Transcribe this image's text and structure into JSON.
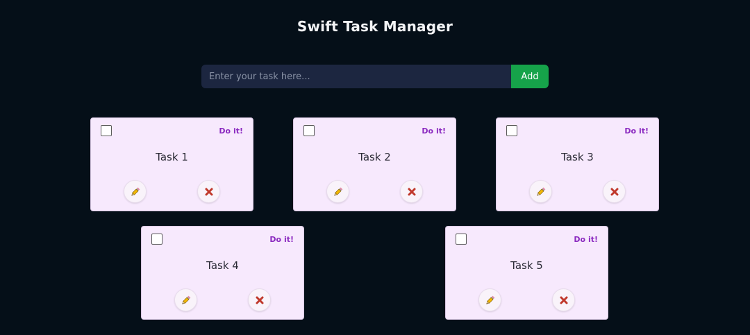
{
  "header": {
    "title": "Swift Task Manager"
  },
  "form": {
    "placeholder": "Enter your task here...",
    "add_label": "Add"
  },
  "colors": {
    "background": "#050f18",
    "card": "#f7e9fd",
    "status_text": "#8b2ac0",
    "add_button": "#16a34a",
    "input_background": "#1c2640"
  },
  "tasks": [
    {
      "name": "Task 1",
      "status": "Do it!",
      "completed": false,
      "edit_icon": "pencil-icon",
      "delete_icon": "close-x-icon"
    },
    {
      "name": "Task 2",
      "status": "Do it!",
      "completed": false,
      "edit_icon": "pencil-icon",
      "delete_icon": "close-x-icon"
    },
    {
      "name": "Task 3",
      "status": "Do it!",
      "completed": false,
      "edit_icon": "pencil-icon",
      "delete_icon": "close-x-icon"
    },
    {
      "name": "Task 4",
      "status": "Do it!",
      "completed": false,
      "edit_icon": "pencil-icon",
      "delete_icon": "close-x-icon"
    },
    {
      "name": "Task 5",
      "status": "Do it!",
      "completed": false,
      "edit_icon": "pencil-icon",
      "delete_icon": "close-x-icon"
    }
  ]
}
